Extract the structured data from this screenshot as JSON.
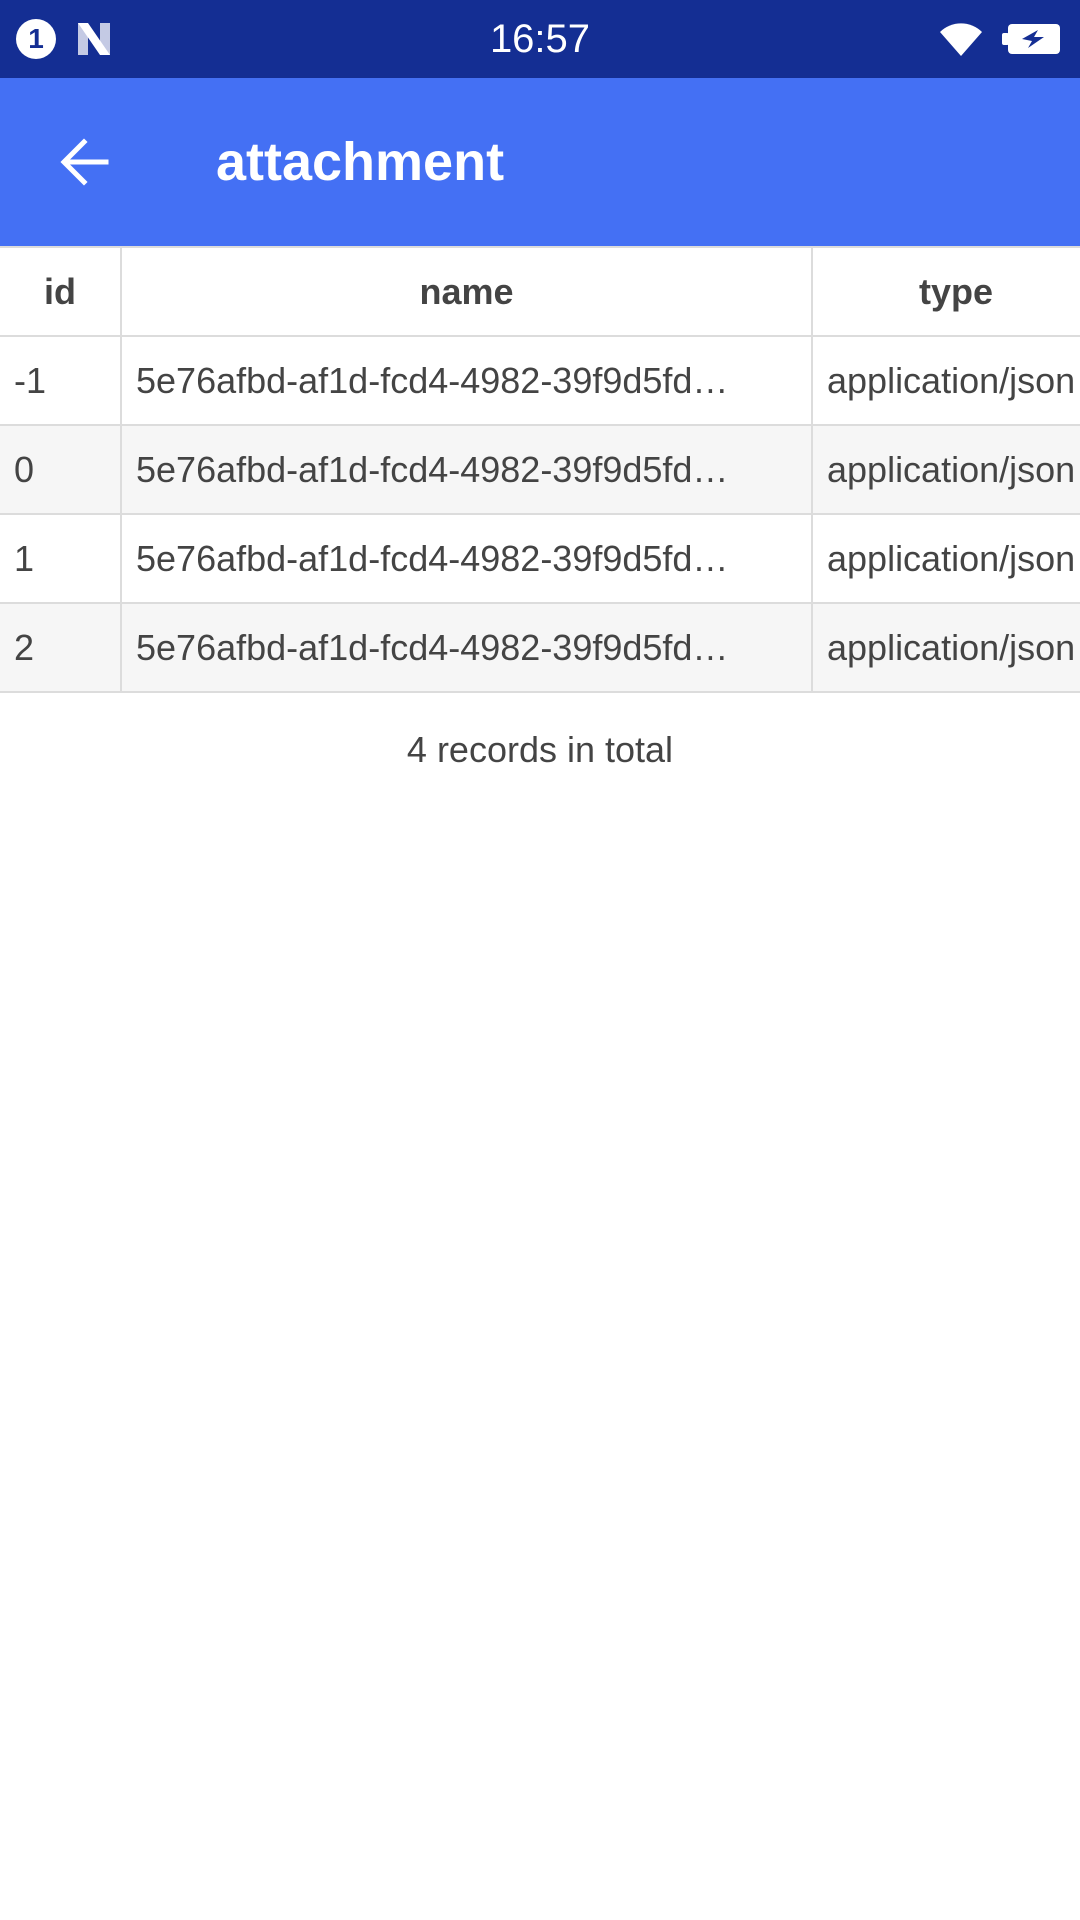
{
  "status_bar": {
    "notification_count": "1",
    "time": "16:57",
    "icons": [
      "notification-badge-icon",
      "n-logo-icon",
      "wifi-icon",
      "battery-charging-icon"
    ]
  },
  "app_bar": {
    "title": "attachment",
    "back_icon": "arrow-left-icon",
    "background_color": "#4470f4"
  },
  "table": {
    "columns": [
      "id",
      "name",
      "type"
    ],
    "rows": [
      {
        "id": "-1",
        "name": "5e76afbd-af1d-fcd4-4982-39f9d5fd…",
        "type": "application/json"
      },
      {
        "id": "0",
        "name": "5e76afbd-af1d-fcd4-4982-39f9d5fd…",
        "type": "application/json"
      },
      {
        "id": "1",
        "name": "5e76afbd-af1d-fcd4-4982-39f9d5fd…",
        "type": "application/json"
      },
      {
        "id": "2",
        "name": "5e76afbd-af1d-fcd4-4982-39f9d5fd…",
        "type": "application/json"
      }
    ]
  },
  "footer": {
    "total_text": "4 records in total"
  },
  "colors": {
    "status_bar": "#142e93",
    "accent": "#4470f4",
    "stripe": "#f6f6f6"
  }
}
